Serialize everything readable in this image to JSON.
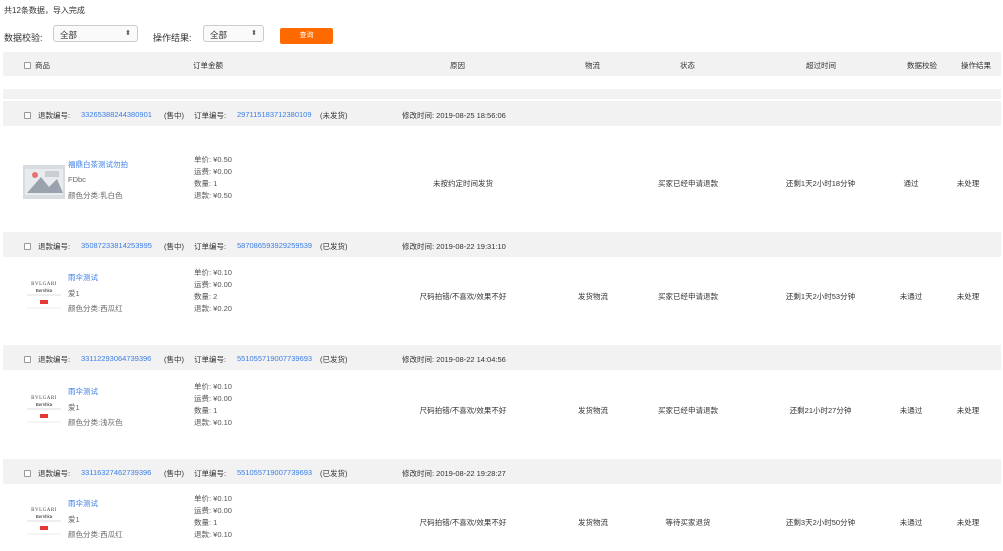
{
  "summary": "共12条数据，导入完成",
  "filters": {
    "check_label": "数据校验:",
    "check_value": "全部",
    "result_label": "操作结果:",
    "result_value": "全部",
    "query_label": "查询"
  },
  "headers": {
    "product": "商品",
    "amount": "订单金额",
    "reason": "原因",
    "logistics": "物流",
    "status": "状态",
    "timeout": "超过时间",
    "check": "数据校验",
    "result": "操作结果"
  },
  "groups": [
    {
      "refund_label": "退款编号:",
      "refund_no": "33265388244380901",
      "refund_state": "(售中)",
      "order_label": "订单编号:",
      "order_no": "297115183712380109",
      "order_state": "(未发货)",
      "modified": "修改时间: 2019-08-25 18:56:06",
      "product": "福鼎白茶测试勿拍",
      "sub1": "FDbc",
      "sub2": "颜色分类:乳白色",
      "unit_price": "单价: ¥0.50",
      "shipping": "运费: ¥0.00",
      "quantity": "数量: 1",
      "refund": "退款: ¥0.50",
      "reason": "未按约定时间发货",
      "logistics": "",
      "status": "买家已经申请退款",
      "timeout": "还剩1天2小时18分钟",
      "check": "通过",
      "result": "未处理",
      "thumb": "tea"
    },
    {
      "refund_label": "退款编号:",
      "refund_no": "35087233814253995",
      "refund_state": "(售中)",
      "order_label": "订单编号:",
      "order_no": "587086593929259539",
      "order_state": "(已发货)",
      "modified": "修改时间: 2019-08-22 19:31:10",
      "product": "雨伞测试",
      "sub1": "爱1",
      "sub2": "颜色分类:西瓜红",
      "unit_price": "单价: ¥0.10",
      "shipping": "运费: ¥0.00",
      "quantity": "数量: 2",
      "refund": "退款: ¥0.20",
      "reason": "尺码拍错/不喜欢/效果不好",
      "logistics": "发货物流",
      "status": "买家已经申请退款",
      "timeout": "还剩1天2小时53分钟",
      "check": "未通过",
      "result": "未处理",
      "thumb": "bvlgari"
    },
    {
      "refund_label": "退款编号:",
      "refund_no": "33112293064739396",
      "refund_state": "(售中)",
      "order_label": "订单编号:",
      "order_no": "551055719007739693",
      "order_state": "(已发货)",
      "modified": "修改时间: 2019-08-22 14:04:56",
      "product": "雨伞测试",
      "sub1": "爱1",
      "sub2": "颜色分类:浅灰色",
      "unit_price": "单价: ¥0.10",
      "shipping": "运费: ¥0.00",
      "quantity": "数量: 1",
      "refund": "退款: ¥0.10",
      "reason": "尺码拍错/不喜欢/效果不好",
      "logistics": "发货物流",
      "status": "买家已经申请退款",
      "timeout": "还剩21小时27分钟",
      "check": "未通过",
      "result": "未处理",
      "thumb": "bvlgari"
    },
    {
      "refund_label": "退款编号:",
      "refund_no": "33116327462739396",
      "refund_state": "(售中)",
      "order_label": "订单编号:",
      "order_no": "551055719007739693",
      "order_state": "(已发货)",
      "modified": "修改时间: 2019-08-22 19:28:27",
      "product": "雨伞测试",
      "sub1": "爱1",
      "sub2": "颜色分类:西瓜红",
      "unit_price": "单价: ¥0.10",
      "shipping": "运费: ¥0.00",
      "quantity": "数量: 1",
      "refund": "退款: ¥0.10",
      "reason": "尺码拍错/不喜欢/效果不好",
      "logistics": "发货物流",
      "status": "等待买家退货",
      "timeout": "还剩3天2小时50分钟",
      "check": "未通过",
      "result": "未处理",
      "thumb": "bvlgari"
    }
  ],
  "thumb_text": {
    "brand": "BVLGARI",
    "sub": "Bershka"
  },
  "colors": {
    "accent": "#ff6a00",
    "link": "#3a7ee6",
    "row_bg": "#f2f2f2"
  }
}
